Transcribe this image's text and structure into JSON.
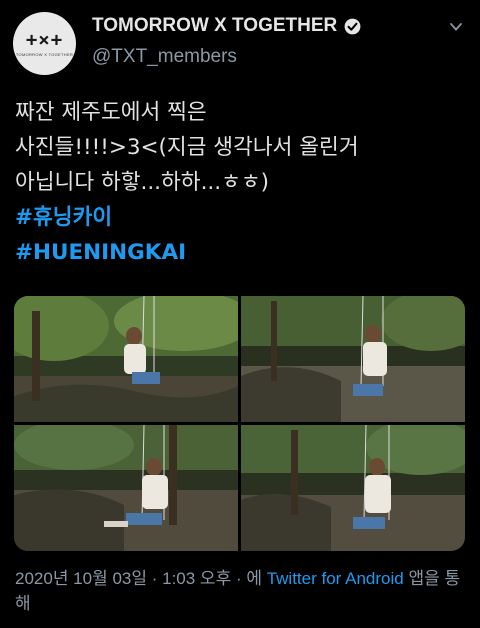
{
  "account": {
    "display_name": "TOMORROW X TOGETHER",
    "handle": "@TXT_members",
    "avatar_logo": "+×+",
    "avatar_sub": "TOMORROW X TOGETHER",
    "verified_icon": "verified-badge-icon"
  },
  "tweet": {
    "text": "짜잔 제주도에서 찍은\n사진들!!!!>3<(지금 생각나서 올린거\n아닙니다 하핳...하하...ㅎㅎ)",
    "hashtags": [
      "#휴닝카이",
      "#HUENINGKAI"
    ]
  },
  "media": {
    "count": 4,
    "alts": [
      "photo-1",
      "photo-2",
      "photo-3",
      "photo-4"
    ]
  },
  "meta": {
    "date": "2020년 10월 03일",
    "sep1": " · ",
    "time": "1:03 오후",
    "sep2": " · 에 ",
    "source_link": "Twitter for Android",
    "suffix": " 앱을 통해"
  },
  "colors": {
    "background": "#000000",
    "link": "#1d9bf0",
    "secondary_text": "#8b98a5"
  }
}
